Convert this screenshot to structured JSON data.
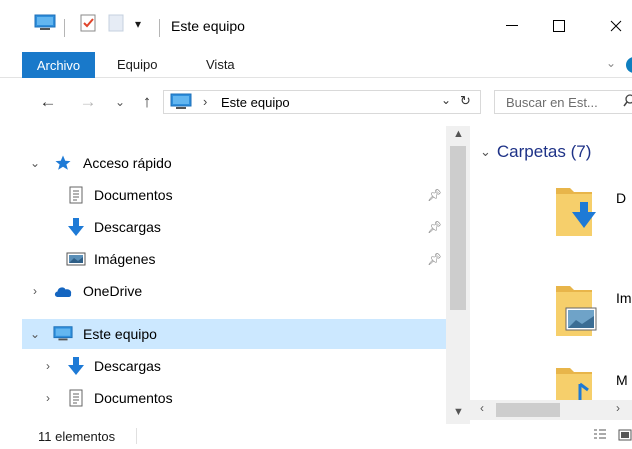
{
  "window": {
    "title": "Este equipo",
    "minimize": "—",
    "maximize": "☐",
    "close": "✕"
  },
  "ribbon": {
    "tabs": [
      "Archivo",
      "Equipo",
      "Vista"
    ],
    "active": "Archivo",
    "accent": "#1979ca"
  },
  "nav": {
    "back": "←",
    "forward": "→",
    "recent": "⌄",
    "up": "↑"
  },
  "address": {
    "separator": "›",
    "location": "Este equipo",
    "dropdown": "⌄",
    "refresh": "↻"
  },
  "search": {
    "placeholder": "Buscar en Est...",
    "icon": "search-icon"
  },
  "tree": {
    "items": [
      {
        "label": "Acceso rápido",
        "icon": "star-icon",
        "chevron": "⌄",
        "pinned": false,
        "selected": false
      },
      {
        "label": "Documentos",
        "icon": "documents-icon",
        "chevron": "",
        "pinned": true,
        "selected": false
      },
      {
        "label": "Descargas",
        "icon": "download-arrow-icon",
        "chevron": "",
        "pinned": true,
        "selected": false
      },
      {
        "label": "Imágenes",
        "icon": "pictures-icon",
        "chevron": "",
        "pinned": true,
        "selected": false
      },
      {
        "label": "OneDrive",
        "icon": "cloud-icon",
        "chevron": "›",
        "pinned": false,
        "selected": false
      },
      {
        "label": "Este equipo",
        "icon": "computer-icon",
        "chevron": "⌄",
        "pinned": false,
        "selected": true
      },
      {
        "label": "Descargas",
        "icon": "download-arrow-icon",
        "chevron": "›",
        "pinned": false,
        "selected": false
      },
      {
        "label": "Documentos",
        "icon": "documents-icon",
        "chevron": "›",
        "pinned": false,
        "selected": false
      }
    ],
    "selected_color": "#cce8ff"
  },
  "content": {
    "group_header": "Carpetas (7)",
    "group_chevron": "⌄",
    "folders": [
      {
        "label": "D",
        "icon": "downloads-folder-icon"
      },
      {
        "label": "Im",
        "icon": "pictures-folder-icon"
      },
      {
        "label": "M",
        "icon": "music-folder-icon"
      }
    ],
    "header_color": "#1e3287"
  },
  "status": {
    "count": "11 elementos",
    "details_view_icon": "details-view-icon",
    "tiles_view_icon": "large-icons-view-icon"
  }
}
